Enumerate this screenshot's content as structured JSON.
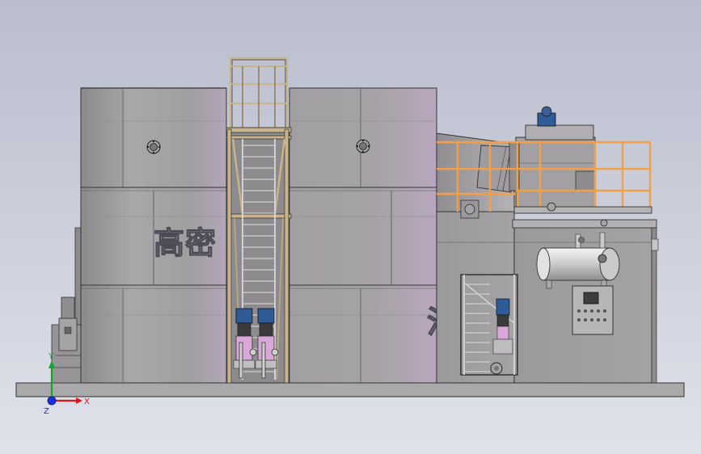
{
  "model_view": {
    "tank_lettering_left": "高密",
    "tank_lettering_right": "池",
    "triad": {
      "x_label": "X",
      "y_label": "Y",
      "z_label": "Z",
      "x_color": "#e0151b",
      "y_color": "#15a52b",
      "z_color": "#1a2fe0"
    },
    "colors": {
      "background_top": "#b9bdcd",
      "background_bottom": "#dfe2ea",
      "tank": "#a3a0a2",
      "railing": "#f2a048",
      "base": "#a9a9ab",
      "pump_motor": "#2f5b96",
      "pump_body": "#d9a7d8"
    }
  }
}
